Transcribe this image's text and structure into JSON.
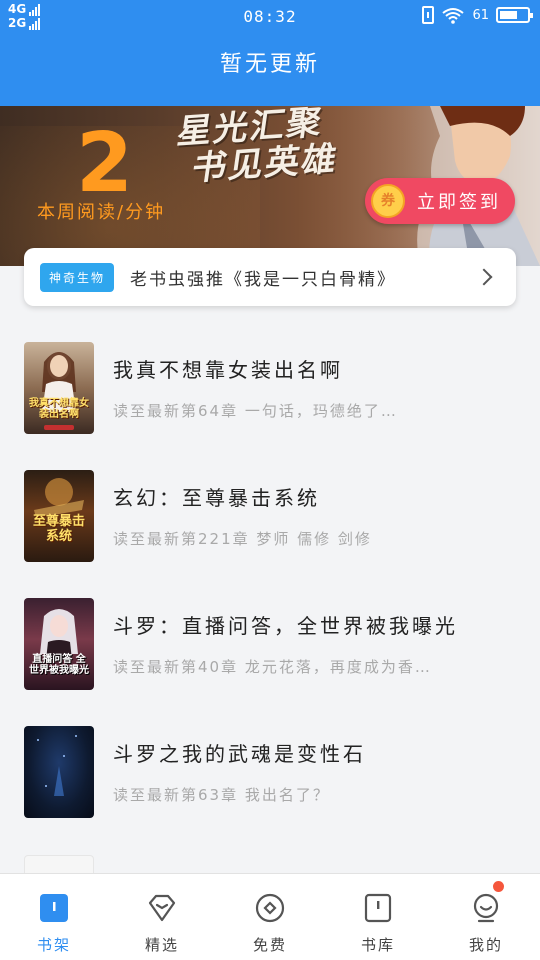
{
  "status_bar": {
    "net1": "4G",
    "net2": "2G",
    "time": "08:32",
    "battery_text": "61"
  },
  "header": {
    "title": "暂无更新"
  },
  "banner": {
    "slogan_line1": "星光汇聚",
    "slogan_line2": "书见英雄",
    "read_minutes": "2",
    "read_label": "本周阅读/分钟",
    "signin_coin": "券",
    "signin_label": "立即签到"
  },
  "recommend": {
    "tag": "神奇生物",
    "text": "老书虫强推《我是一只白骨精》"
  },
  "books": [
    {
      "title": "我真不想靠女装出名啊",
      "progress": "读至最新第64章 一句话，玛德绝了…",
      "cover_text": "我真不想靠女装出名啊"
    },
    {
      "title": "玄幻：至尊暴击系统",
      "progress": "读至最新第221章 梦师 儒修 剑修",
      "cover_text": "至尊暴击系统"
    },
    {
      "title": "斗罗：直播问答，全世界被我曝光",
      "progress": "读至最新第40章 龙元花落，再度成为香…",
      "cover_text": "直播问答 全世界被我曝光"
    },
    {
      "title": "斗罗之我的武魂是变性石",
      "progress": "读至最新第63章 我出名了？",
      "cover_text": ""
    }
  ],
  "nav": [
    {
      "label": "书架",
      "icon": "bookshelf-icon",
      "active": true
    },
    {
      "label": "精选",
      "icon": "diamond-icon",
      "active": false
    },
    {
      "label": "免费",
      "icon": "free-icon",
      "active": false
    },
    {
      "label": "书库",
      "icon": "library-icon",
      "active": false
    },
    {
      "label": "我的",
      "icon": "profile-icon",
      "active": false
    }
  ],
  "colors": {
    "primary": "#2f8ef0",
    "signin": "#f04962",
    "orange": "#ff9a1f",
    "badge": "#f5563c"
  }
}
